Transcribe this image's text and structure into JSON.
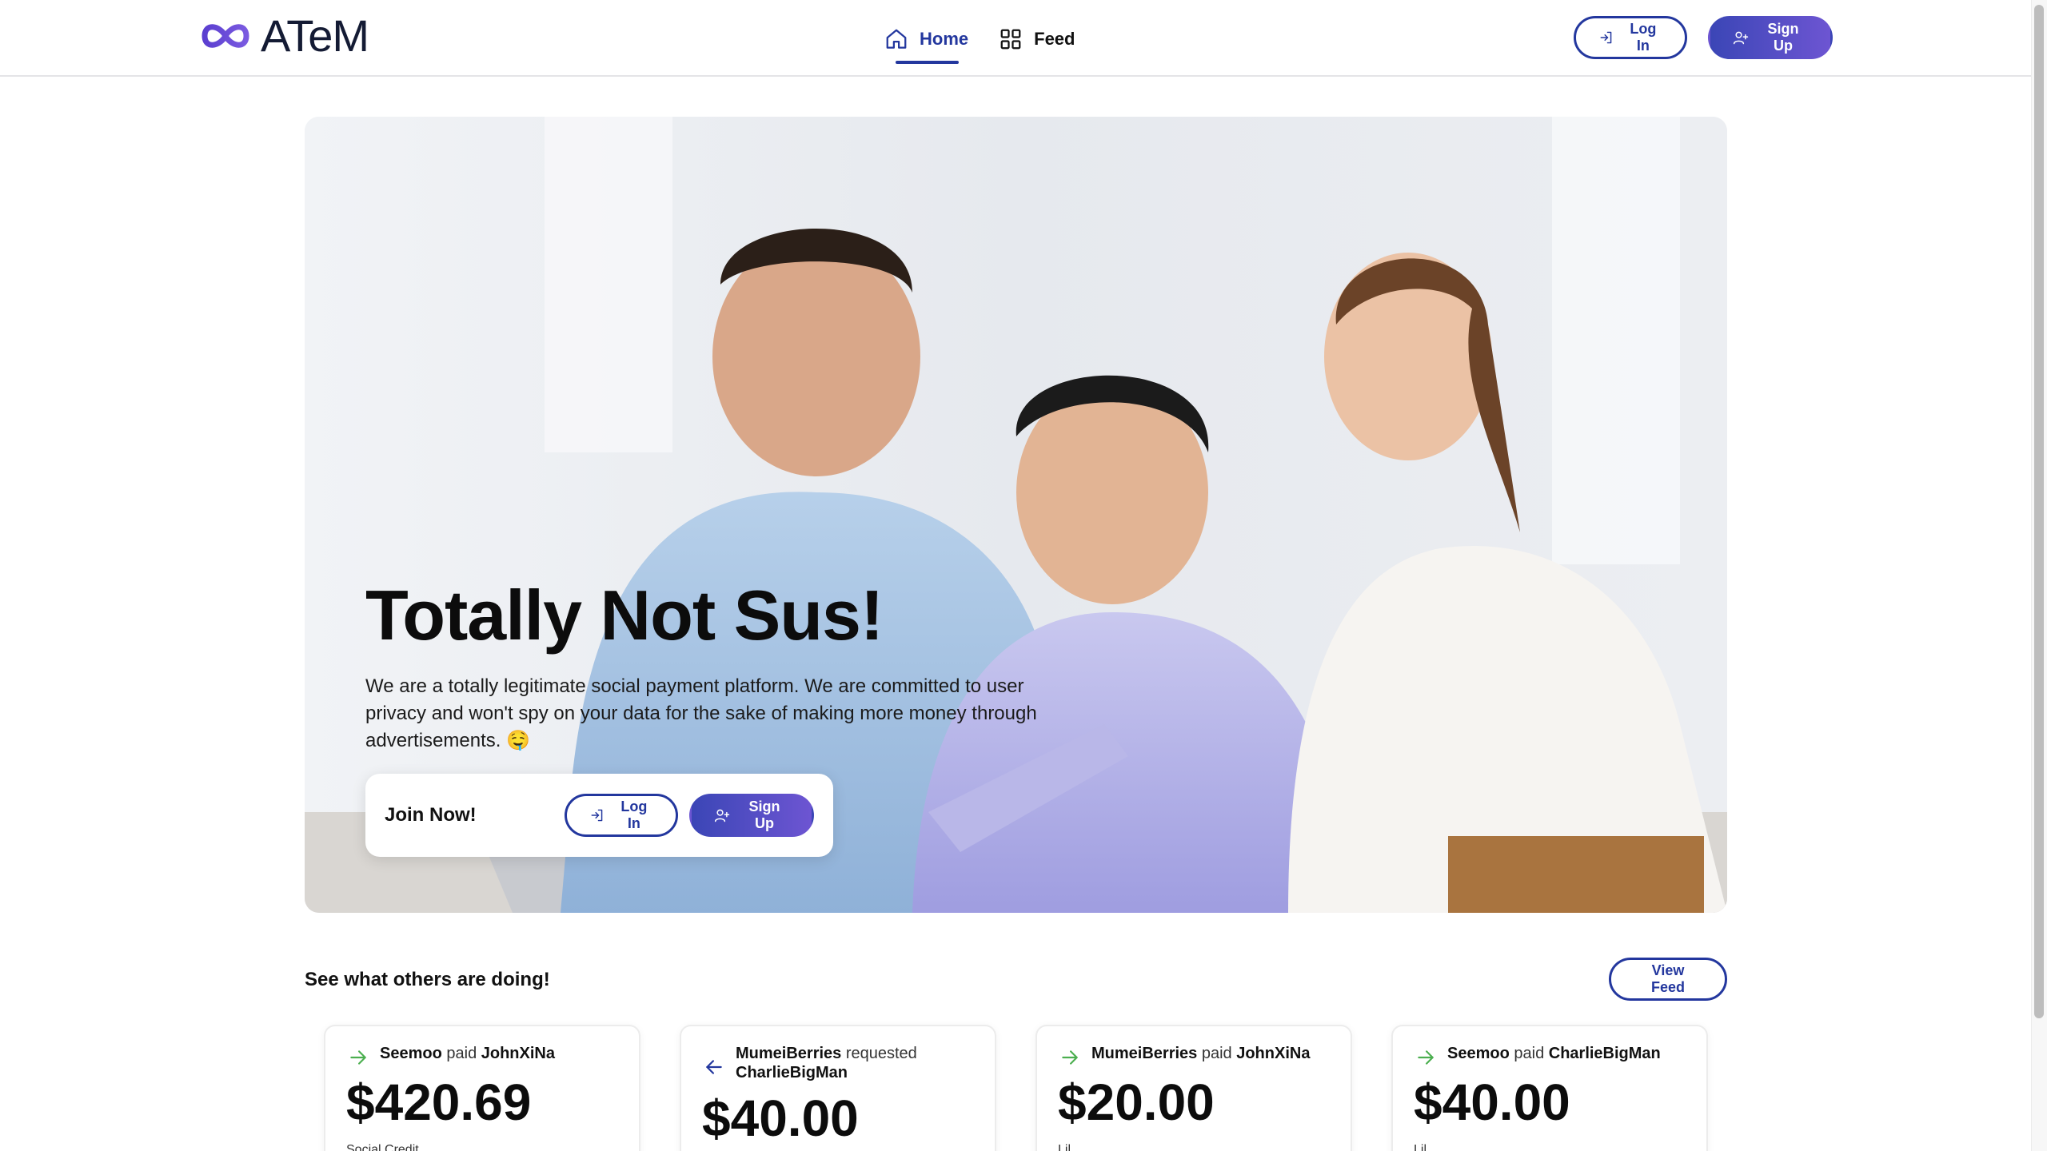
{
  "brand": {
    "name": "ATeM"
  },
  "nav": {
    "items": [
      {
        "label": "Home",
        "icon": "home-icon",
        "active": true
      },
      {
        "label": "Feed",
        "icon": "grid-icon",
        "active": false
      }
    ],
    "login_label": "Log In",
    "signup_label": "Sign Up"
  },
  "hero": {
    "title": "Totally Not Sus!",
    "description": "We are a totally legitimate social payment platform. We are committed to user privacy and won't spy on your data for the sake of making more money through advertisements. 🤤",
    "join_label": "Join Now!",
    "login_label": "Log In",
    "signup_label": "Sign Up"
  },
  "feed": {
    "heading": "See what others are doing!",
    "view_feed_label": "View Feed",
    "cards": [
      {
        "direction": "paid",
        "from": "Seemoo",
        "action": "paid",
        "to": "JohnXiNa",
        "amount": "$420.69",
        "memo": "Social Credit"
      },
      {
        "direction": "requested",
        "from": "MumeiBerries",
        "action": "requested",
        "to": "CharlieBigMan",
        "amount": "$40.00",
        "memo": ""
      },
      {
        "direction": "paid",
        "from": "MumeiBerries",
        "action": "paid",
        "to": "JohnXiNa",
        "amount": "$20.00",
        "memo": "Lil"
      },
      {
        "direction": "paid",
        "from": "Seemoo",
        "action": "paid",
        "to": "CharlieBigMan",
        "amount": "$40.00",
        "memo": "Lil"
      }
    ]
  },
  "colors": {
    "primary": "#23379e",
    "accent_gradient_start": "#3b46b6",
    "accent_gradient_end": "#6d55d2",
    "paid_arrow": "#4caf50",
    "request_arrow": "#23379e"
  }
}
